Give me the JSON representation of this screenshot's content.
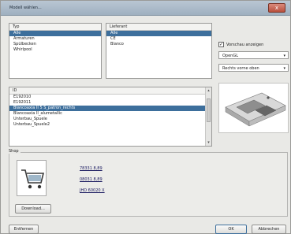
{
  "window": {
    "title": "Modell wählen...",
    "close_label": "x"
  },
  "typ": {
    "header": "Typ",
    "items": [
      "Alle",
      "Armaturen",
      "Spülbecken",
      "Whirlpool"
    ],
    "selected_index": 0
  },
  "lieferant": {
    "header": "Lieferant",
    "items": [
      "Alle",
      "CE",
      "Blanco"
    ],
    "selected_index": 0
  },
  "preview_options": {
    "checkbox_label": "Vorschau anzeigen",
    "checked": true,
    "renderer": "OpenGL",
    "view": "Rechts vorne oben"
  },
  "id_list": {
    "header": "ID",
    "items": [
      "E192010",
      "E192011",
      "Blancoaxia II 5 S_patron_rechts",
      "Blancoaxia II_alumetallic",
      "Unterbau_Spuele",
      "Unterbau_Spuele2"
    ],
    "selected_index": 2
  },
  "shop": {
    "label": "Shop",
    "links": [
      "78331 8,89",
      "08031 8,89",
      "JHD 60020 X"
    ],
    "download_label": "Download..."
  },
  "footer": {
    "remove_label": "Entfernen",
    "ok_label": "OK",
    "cancel_label": "Abbrechen"
  }
}
